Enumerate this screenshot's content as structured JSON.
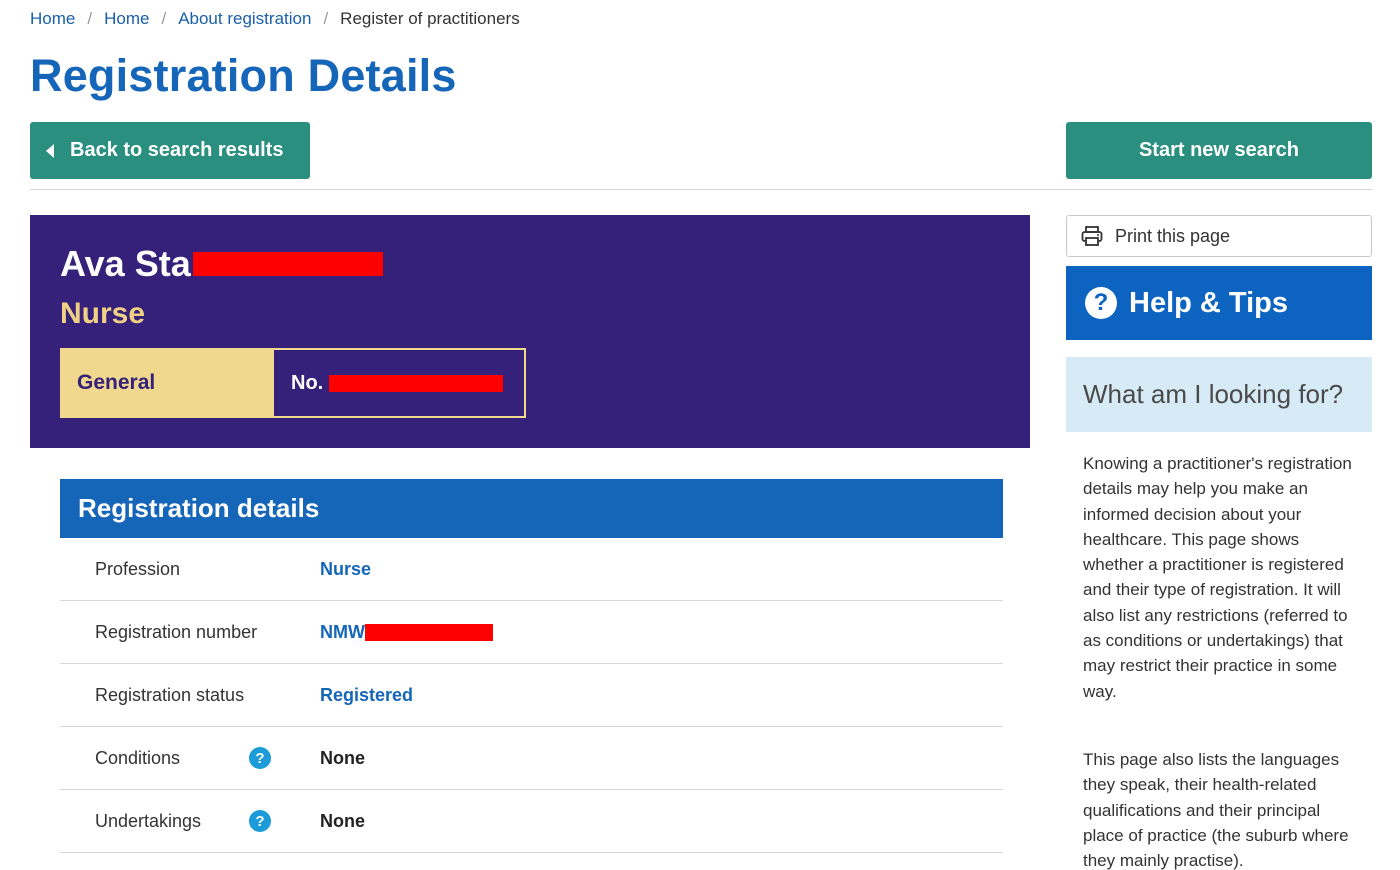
{
  "breadcrumb": {
    "items": [
      "Home",
      "Home",
      "About registration"
    ],
    "current": "Register of practitioners",
    "separator": "/"
  },
  "page_title": "Registration Details",
  "buttons": {
    "back": "Back to search results",
    "new_search": "Start new search",
    "print": "Print this page"
  },
  "practitioner": {
    "name_visible": "Ava Sta",
    "profession": "Nurse",
    "registration_type": "General",
    "number_label": "No."
  },
  "details": {
    "header": "Registration details",
    "rows": [
      {
        "label": "Profession",
        "value": "Nurse"
      },
      {
        "label": "Registration number",
        "value": "NMW"
      },
      {
        "label": "Registration status",
        "value": "Registered"
      },
      {
        "label": "Conditions",
        "value": "None"
      },
      {
        "label": "Undertakings",
        "value": "None"
      }
    ]
  },
  "sidebar": {
    "help_title": "Help & Tips",
    "looking_for": "What am I looking for?",
    "paragraph1": "Knowing a practitioner's registration details may help you make an informed decision about your healthcare. This page shows whether a practitioner is registered and their type of registration. It will also list any restrictions (referred to as conditions or undertakings) that may restrict their practice in some way.",
    "paragraph2": "This page also lists the languages they speak, their health-related qualifications and their principal place of practice (the suburb where they mainly practise)."
  },
  "icons": {
    "help": "question-circle-icon",
    "print": "printer-icon",
    "back": "caret-left-icon"
  },
  "colors": {
    "primary_blue": "#1565b8",
    "green": "#2a8f7f",
    "hero_purple": "#35207a",
    "badge_gold": "#f0d88f",
    "light_blue": "#d7ebf6",
    "redaction": "#ff0000"
  }
}
